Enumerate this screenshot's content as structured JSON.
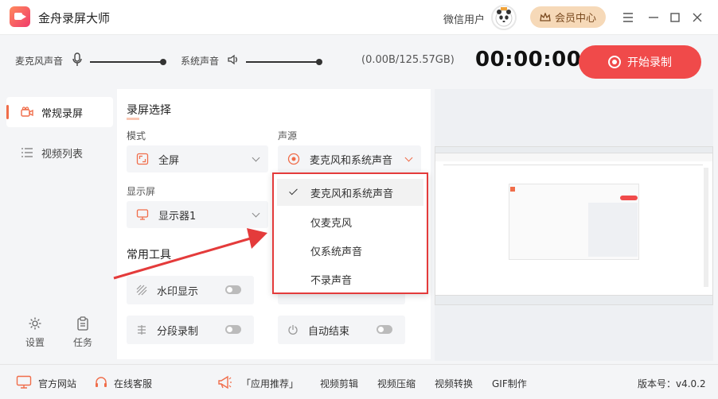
{
  "titlebar": {
    "app_title": "金舟录屏大师",
    "user_label": "微信用户",
    "vip_label": "会员中心"
  },
  "audio": {
    "mic_label": "麦克风声音",
    "mic_level": 1.0,
    "system_label": "系统声音",
    "system_level": 1.0,
    "storage": "(0.00B/125.57GB)",
    "timer": "00:00:00",
    "start_label": "开始录制"
  },
  "sidebar": {
    "items": [
      {
        "label": "常规录屏",
        "active": true
      },
      {
        "label": "视频列表",
        "active": false
      }
    ],
    "settings_label": "设置",
    "tasks_label": "任务"
  },
  "main": {
    "section_screen": "录屏选择",
    "mode_label": "模式",
    "mode_value": "全屏",
    "source_label": "声源",
    "source_value": "麦克风和系统声音",
    "display_label": "显示屏",
    "display_value": "显示器1",
    "section_tools": "常用工具",
    "tools": [
      {
        "label": "水印显示",
        "on": false
      },
      {
        "label": "分段录制",
        "on": false
      },
      {
        "label": "自动结束",
        "on": false
      }
    ]
  },
  "dropdown": {
    "options": [
      {
        "label": "麦克风和系统声音",
        "selected": true
      },
      {
        "label": "仅麦克风",
        "selected": false
      },
      {
        "label": "仅系统声音",
        "selected": false
      },
      {
        "label": "不录声音",
        "selected": false
      }
    ]
  },
  "footer": {
    "website": "官方网站",
    "support": "在线客服",
    "recommend": "「应用推荐」",
    "links": [
      "视频剪辑",
      "视频压缩",
      "视频转换",
      "GIF制作"
    ],
    "version": "版本号：v4.0.2"
  },
  "colors": {
    "accent": "#f04a4a",
    "vip_bg": "#f6d9b8",
    "highlight_border": "#e43b3b"
  }
}
